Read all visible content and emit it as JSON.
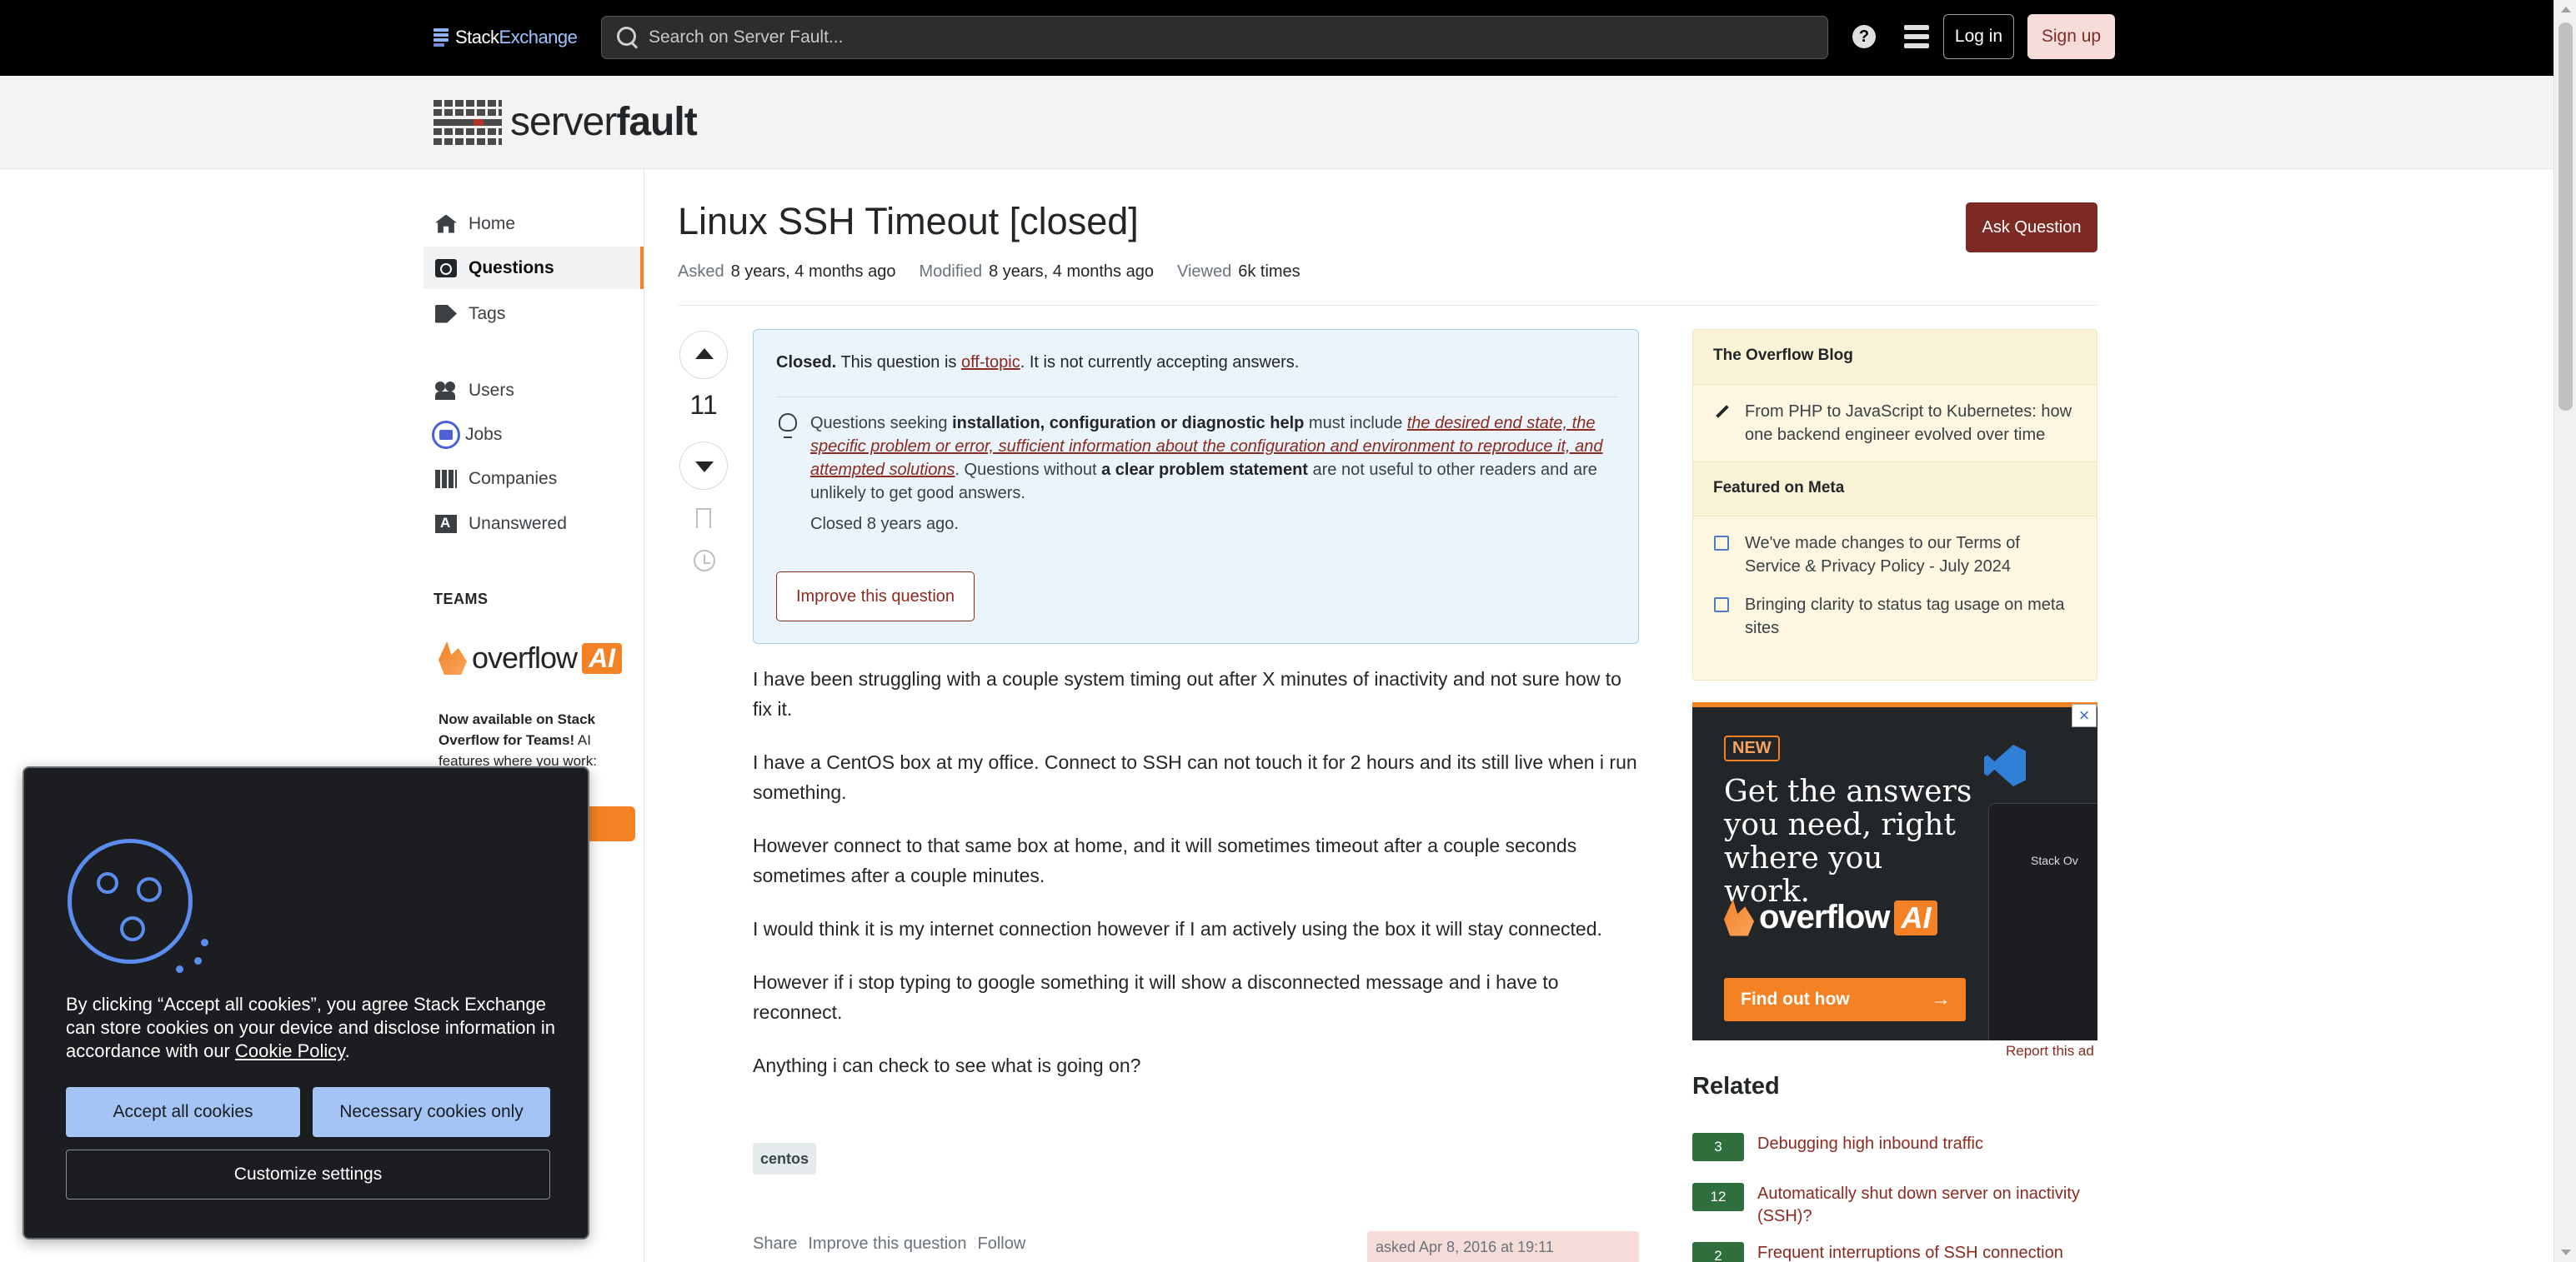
{
  "topbar": {
    "logo_a": "Stack",
    "logo_b": "Exchange",
    "search_placeholder": "Search on Server Fault...",
    "login": "Log in",
    "signup": "Sign up"
  },
  "site": {
    "logo_light": "server",
    "logo_bold": "fault"
  },
  "nav": {
    "home": "Home",
    "questions": "Questions",
    "tags": "Tags",
    "users": "Users",
    "jobs": "Jobs",
    "companies": "Companies",
    "unanswered": "Unanswered",
    "teams_label": "TEAMS",
    "teams_logo_word": "overflow",
    "teams_logo_ai": "AI",
    "teams_text_bold": "Now available on Stack Overflow for Teams!",
    "teams_text": " AI features where you work:"
  },
  "question": {
    "title": "Linux SSH Timeout [closed]",
    "ask_button": "Ask Question",
    "asked_label": "Asked",
    "asked_value": "8 years, 4 months ago",
    "modified_label": "Modified",
    "modified_value": "8 years, 4 months ago",
    "viewed_label": "Viewed",
    "viewed_value": "6k times",
    "votes": "11",
    "notice": {
      "closed_bold": "Closed.",
      "closed_pre": " This question is ",
      "closed_link": "off-topic",
      "closed_post": ". It is not currently accepting answers.",
      "body_1": "Questions seeking ",
      "body_b1": "installation, configuration or diagnostic help",
      "body_2": " must include ",
      "body_link": "the desired end state, the specific problem or error, sufficient information about the configuration and environment to reproduce it, and attempted solutions",
      "body_3": ". Questions without ",
      "body_b2": "a clear problem statement",
      "body_4": " are not useful to other readers and are unlikely to get good answers.",
      "closed_time": "Closed 8 years ago.",
      "improve": "Improve this question"
    },
    "paragraphs": [
      "I have been struggling with a couple system timing out after X minutes of inactivity and not sure how to fix it.",
      "I have a CentOS box at my office. Connect to SSH can not touch it for 2 hours and its still live when i run something.",
      "However connect to that same box at home, and it will sometimes timeout after a couple seconds sometimes after a couple minutes.",
      "I would think it is my internet connection however if I am actively using the box it will stay connected.",
      "However if i stop typing to google something it will show a disconnected message and i have to reconnect.",
      "Anything i can check to see what is going on?"
    ],
    "tag": "centos",
    "menu": {
      "share": "Share",
      "improve": "Improve this question",
      "follow": "Follow"
    },
    "asked_box": "asked Apr 8, 2016 at 19:11"
  },
  "sidebar": {
    "blog_head": "The Overflow Blog",
    "blog_item": "From PHP to JavaScript to Kubernetes: how one backend engineer evolved over time",
    "meta_head": "Featured on Meta",
    "meta_items": [
      "We've made changes to our Terms of Service & Privacy Policy - July 2024",
      "Bringing clarity to status tag usage on meta sites"
    ],
    "ad": {
      "new": "NEW",
      "headline": "Get the answers you need, right where you work.",
      "logo_word": "overflow",
      "logo_ai": "AI",
      "cta": "Find out how",
      "cta_arrow": "→",
      "shot_text": "Stack Ov"
    },
    "report_ad": "Report this ad",
    "related_head": "Related",
    "related": [
      {
        "score": "3",
        "title": "Debugging high inbound traffic"
      },
      {
        "score": "12",
        "title": "Automatically shut down server on inactivity (SSH)?"
      },
      {
        "score": "2",
        "title": "Frequent interruptions of SSH connection"
      }
    ]
  },
  "cookie": {
    "text": "By clicking “Accept all cookies”, you agree Stack Exchange can store cookies on your device and disclose information in accordance with our ",
    "link": "Cookie Policy",
    "text_end": ".",
    "accept": "Accept all cookies",
    "necessary": "Necessary cookies only",
    "customize": "Customize settings"
  },
  "colors": {
    "accent": "#f48225",
    "brand_dark_red": "#7c2a23",
    "link_red": "#8b2a1f",
    "notice_bg": "#ebf4fb",
    "answered_green": "#2f6f3e"
  }
}
